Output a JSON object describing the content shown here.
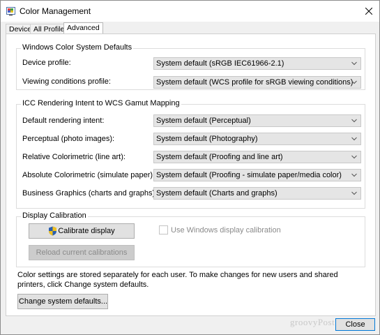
{
  "window": {
    "title": "Color Management",
    "icons": {
      "app": "color-management-icon",
      "close": "close-icon"
    }
  },
  "tabs": [
    {
      "label": "Devices",
      "active": false
    },
    {
      "label": "All Profiles",
      "active": false
    },
    {
      "label": "Advanced",
      "active": true
    }
  ],
  "wcs_defaults": {
    "title": "Windows Color System Defaults",
    "device_profile": {
      "label": "Device profile:",
      "value": "System default (sRGB IEC61966-2.1)"
    },
    "viewing_conditions": {
      "label": "Viewing conditions profile:",
      "value": "System default (WCS profile for sRGB viewing conditions)"
    }
  },
  "icc_mapping": {
    "title": "ICC Rendering Intent to WCS Gamut Mapping",
    "rows": [
      {
        "label": "Default rendering intent:",
        "value": "System default (Perceptual)"
      },
      {
        "label": "Perceptual (photo images):",
        "value": "System default (Photography)"
      },
      {
        "label": "Relative Colorimetric (line art):",
        "value": "System default (Proofing and line art)"
      },
      {
        "label": "Absolute Colorimetric (simulate paper):",
        "value": "System default (Proofing - simulate paper/media color)"
      },
      {
        "label": "Business Graphics (charts and graphs):",
        "value": "System default (Charts and graphs)"
      }
    ]
  },
  "calibration": {
    "title": "Display Calibration",
    "calibrate_button": "Calibrate display",
    "reload_button": "Reload current calibrations",
    "use_windows_checkbox": {
      "label": "Use Windows display calibration",
      "checked": false,
      "enabled": false
    }
  },
  "info_text": "Color settings are stored separately for each user. To make changes for new users and shared printers, click Change system defaults.",
  "change_defaults_button": "Change system defaults...",
  "close_button": "Close",
  "watermark": "groovyPost.com",
  "colors": {
    "accent": "#0078d7",
    "combo_bg": "#e5e5e5",
    "disabled_text": "#8a8a8a",
    "window_bg": "#f0f0f0"
  }
}
